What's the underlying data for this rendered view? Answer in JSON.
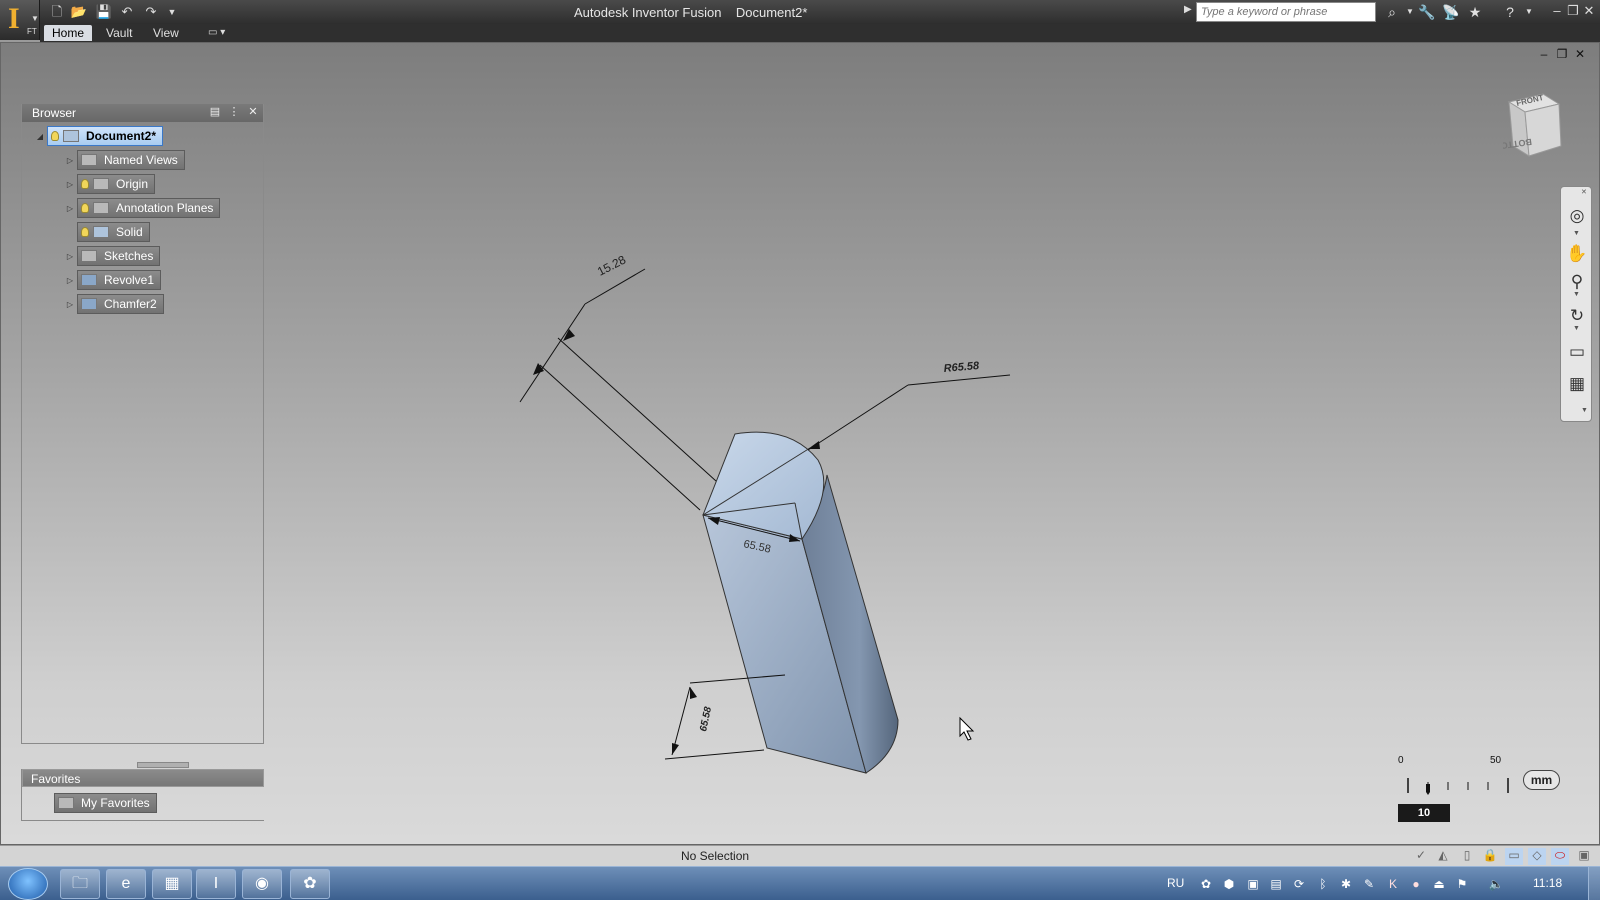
{
  "app": {
    "window_title": "Autodesk Inventor Fusion    Document2*",
    "logo_badge": "FT",
    "search_placeholder": "Type a keyword or phrase"
  },
  "menu": {
    "tabs": [
      "Home",
      "Vault",
      "View"
    ],
    "active_tab": "Home"
  },
  "browser": {
    "title": "Browser",
    "tree": [
      {
        "label": "Document2*",
        "level": 0,
        "expander": "open",
        "bulb": true,
        "icon": "part-icon",
        "selected": true
      },
      {
        "label": "Named Views",
        "level": 1,
        "expander": "closed",
        "bulb": false,
        "icon": "folder-icon"
      },
      {
        "label": "Origin",
        "level": 1,
        "expander": "closed",
        "bulb": true,
        "icon": "folder-icon"
      },
      {
        "label": "Annotation Planes",
        "level": 1,
        "expander": "closed",
        "bulb": true,
        "icon": "folder-icon"
      },
      {
        "label": "Solid",
        "level": 1,
        "expander": "none",
        "bulb": true,
        "icon": "solid-icon"
      },
      {
        "label": "Sketches",
        "level": 1,
        "expander": "closed",
        "bulb": false,
        "icon": "folder-icon"
      },
      {
        "label": "Revolve1",
        "level": 1,
        "expander": "closed",
        "bulb": false,
        "icon": "revolve-feature-icon"
      },
      {
        "label": "Chamfer2",
        "level": 1,
        "expander": "closed",
        "bulb": false,
        "icon": "chamfer-feature-icon"
      }
    ]
  },
  "favorites": {
    "title": "Favorites",
    "items": [
      "My Favorites"
    ]
  },
  "viewcube": {
    "face_top": "FRONT",
    "face_front": "BOTTOM"
  },
  "dimensions": {
    "d1": "15.28",
    "d2": "R65.58",
    "d3": "65.58",
    "d4": "65.58"
  },
  "scale": {
    "tick_start": "0",
    "tick_end": "50",
    "value": "10",
    "unit": "mm"
  },
  "status": {
    "text": "No Selection"
  },
  "taskbar": {
    "language": "RU",
    "clock": "11:18"
  }
}
